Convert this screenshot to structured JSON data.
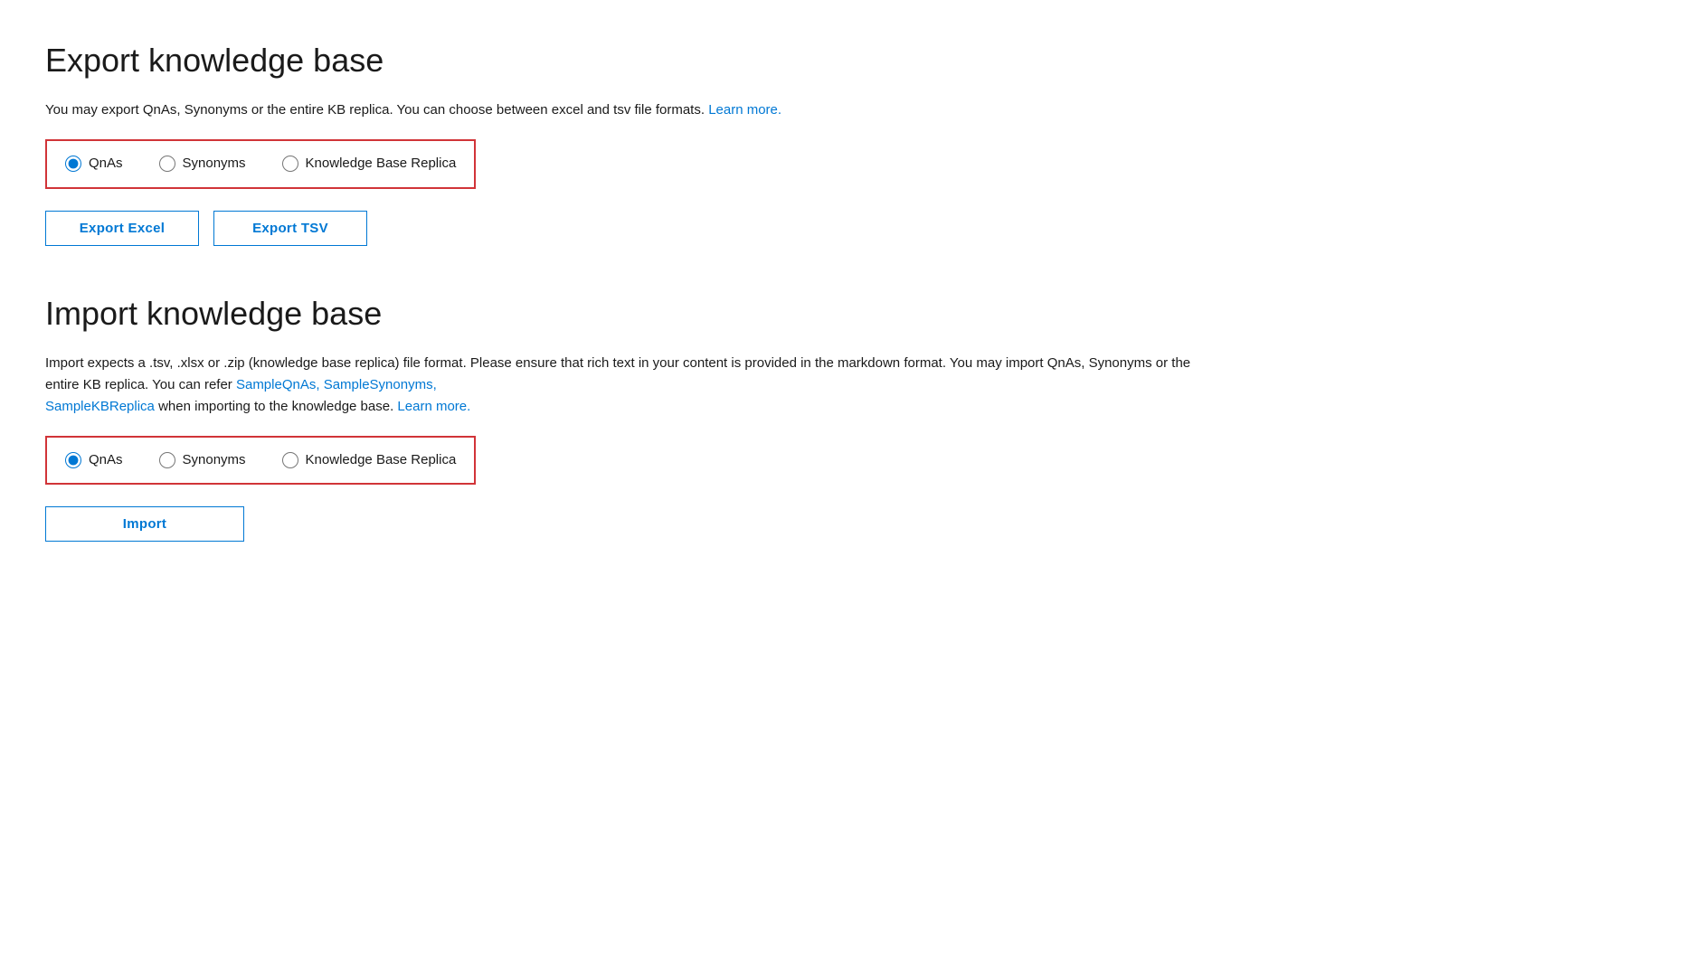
{
  "export_section": {
    "title": "Export knowledge base",
    "description_text": "You may export QnAs, Synonyms or the entire KB replica. You can choose between excel and tsv file formats.",
    "description_link_text": "Learn more.",
    "description_link_href": "#",
    "radio_group": {
      "options": [
        {
          "id": "export-qnas",
          "label": "QnAs",
          "value": "qnas",
          "checked": true
        },
        {
          "id": "export-synonyms",
          "label": "Synonyms",
          "value": "synonyms",
          "checked": false
        },
        {
          "id": "export-kb-replica",
          "label": "Knowledge Base Replica",
          "value": "kb-replica",
          "checked": false
        }
      ]
    },
    "buttons": [
      {
        "id": "export-excel-btn",
        "label": "Export Excel"
      },
      {
        "id": "export-tsv-btn",
        "label": "Export TSV"
      }
    ]
  },
  "import_section": {
    "title": "Import knowledge base",
    "description_lines": [
      "Import expects a .tsv, .xlsx or .zip (knowledge base replica) file format. Please ensure that rich text in your content is provided in the",
      "markdown format. You may import QnAs, Synonyms or the entire KB replica. You can refer"
    ],
    "links": [
      {
        "text": "SampleQnAs,",
        "href": "#"
      },
      {
        "text": "SampleSynonyms,",
        "href": "#"
      },
      {
        "text": "SampleKBReplica",
        "href": "#"
      }
    ],
    "when_text": "when importing to the knowledge base.",
    "learn_more_text": "Learn more.",
    "learn_more_href": "#",
    "radio_group": {
      "options": [
        {
          "id": "import-qnas",
          "label": "QnAs",
          "value": "qnas",
          "checked": true
        },
        {
          "id": "import-synonyms",
          "label": "Synonyms",
          "value": "synonyms",
          "checked": false
        },
        {
          "id": "import-kb-replica",
          "label": "Knowledge Base Replica",
          "value": "kb-replica",
          "checked": false
        }
      ]
    },
    "buttons": [
      {
        "id": "import-btn",
        "label": "Import"
      }
    ]
  }
}
